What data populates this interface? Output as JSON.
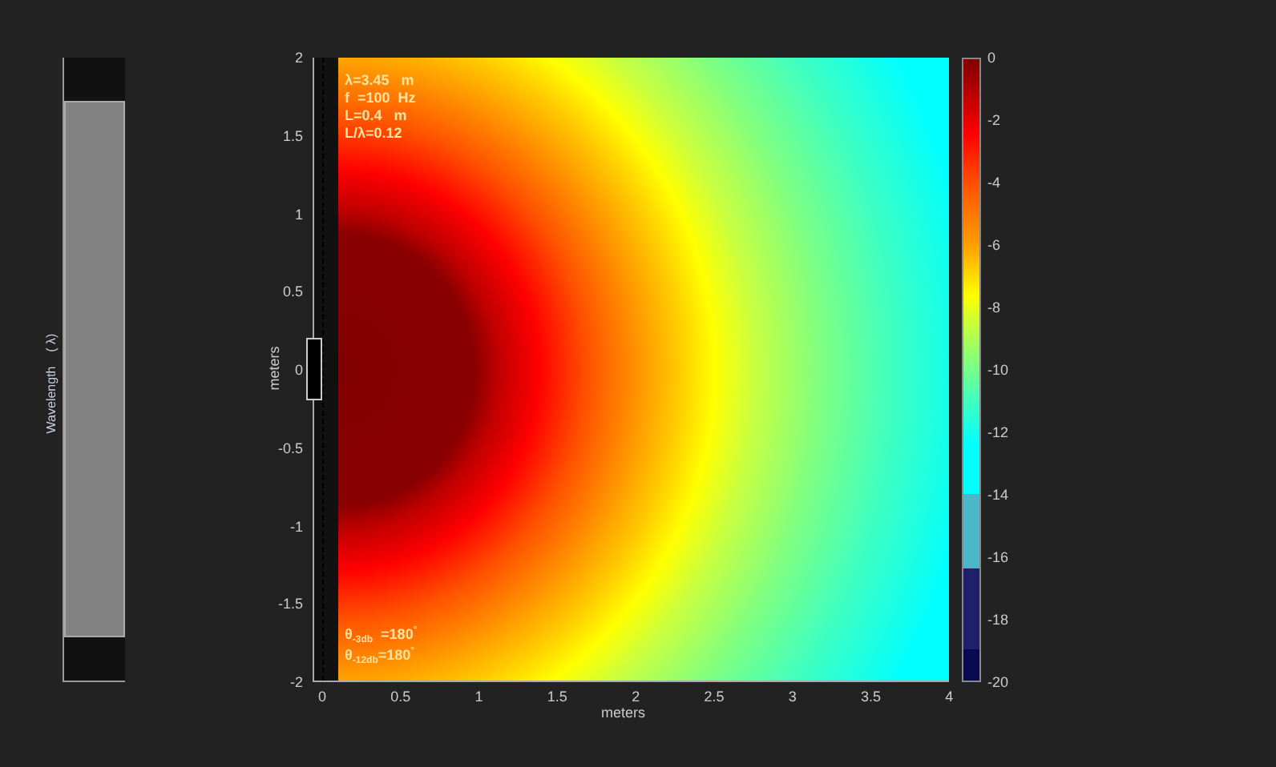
{
  "slider": {
    "label": "Wavelength    ( λ)",
    "level": 0.5
  },
  "plot": {
    "annotations_top": [
      "λ=3.45   m",
      "f  =100  Hz",
      "L=0.4   m",
      "L/λ=0.12"
    ],
    "annotations_bottom": [
      "θ$_{-3db}$  =180$^{°}$",
      "θ$_{-12db}$=180$^{°}$"
    ],
    "xlabel": "meters",
    "ylabel": "meters",
    "xticks": [
      "0",
      "0.5",
      "1",
      "1.5",
      "2",
      "2.5",
      "3",
      "3.5",
      "4"
    ],
    "yticks": [
      "2",
      "1.5",
      "1",
      "0.5",
      "0",
      "-0.5",
      "-1",
      "-1.5",
      "-2"
    ],
    "colorbar_ticks": [
      "0",
      "-2",
      "-4",
      "-6",
      "-8",
      "-10",
      "-12",
      "-14",
      "-16",
      "-18",
      "-20"
    ]
  }
}
